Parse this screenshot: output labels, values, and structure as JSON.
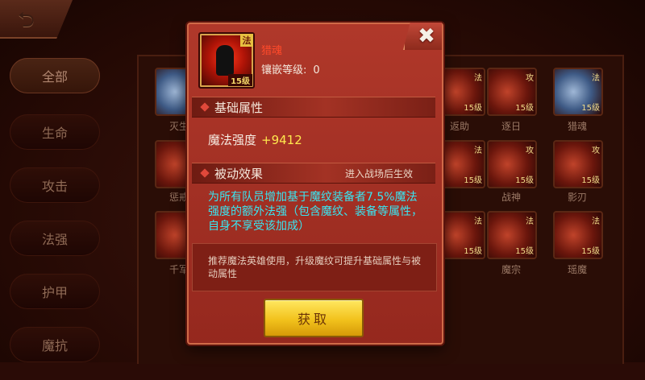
{
  "back": {
    "icon": "back-arrow-icon"
  },
  "categories": [
    "全部",
    "生命",
    "攻击",
    "法强",
    "护甲",
    "魔抗"
  ],
  "grid": {
    "labels": [
      "灭生",
      "惩戒",
      "千军",
      "...",
      "返助",
      "逐日",
      "猎魂",
      "...",
      "...",
      "战神",
      "影刃",
      "...",
      "...",
      "魔宗",
      "瑶魔"
    ]
  },
  "modal": {
    "item_name": "猎魂",
    "item_type_badge": "法",
    "item_level_badge": "15级",
    "inlay_label": "镶嵌等级:",
    "inlay_value": "0",
    "section_base": "基础属性",
    "base_attr_label": "魔法强度",
    "base_attr_value": "+9412",
    "section_passive": "被动效果",
    "passive_note": "进入战场后生效",
    "passive_desc": "为所有队员增加基于魔纹装备者7.5%魔法强度的额外法强（包含魔纹、装备等属性，自身不享受该加成）",
    "recommend": "推荐魔法英雄使用，升级魔纹可提升基础属性与被动属性",
    "get_button": "获取",
    "close_icon": "close-icon"
  }
}
